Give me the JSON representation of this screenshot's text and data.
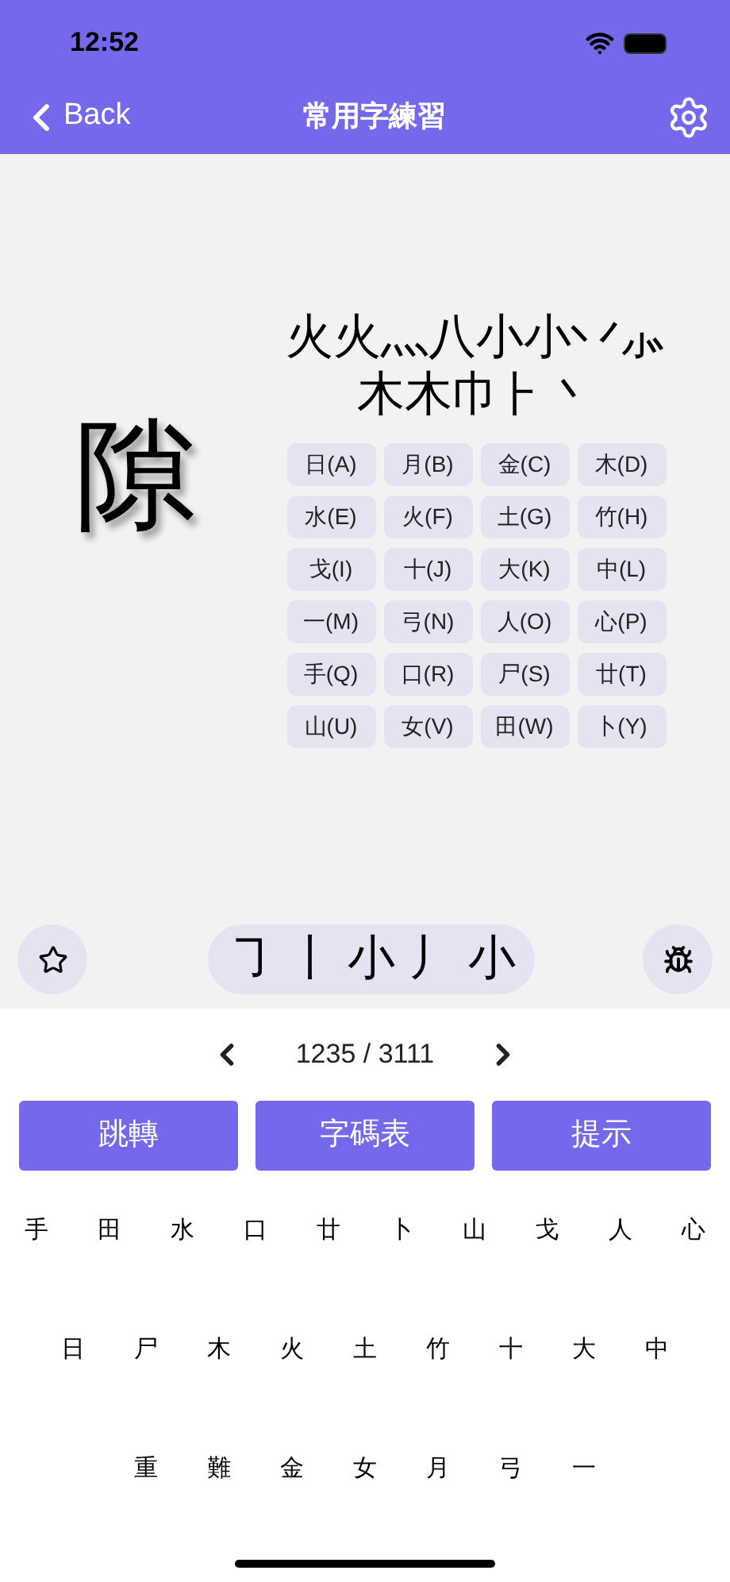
{
  "status_bar": {
    "time": "12:52"
  },
  "nav": {
    "back": "Back",
    "title": "常用字練習"
  },
  "question": {
    "character": "隙",
    "components": [
      [
        "火",
        "火",
        "灬",
        "八",
        "小",
        "小",
        "丷",
        "⺗"
      ],
      [
        "木",
        "木",
        "巾",
        "⺊",
        "丶"
      ]
    ],
    "keys": [
      "日(A)",
      "月(B)",
      "金(C)",
      "木(D)",
      "水(E)",
      "火(F)",
      "土(G)",
      "竹(H)",
      "戈(I)",
      "十(J)",
      "大(K)",
      "中(L)",
      "一(M)",
      "弓(N)",
      "人(O)",
      "心(P)",
      "手(Q)",
      "口(R)",
      "尸(S)",
      "廿(T)",
      "山(U)",
      "女(V)",
      "田(W)",
      "卜(Y)"
    ],
    "input": [
      "㇆",
      "丨",
      "小",
      "丿",
      "小"
    ]
  },
  "pager": {
    "text": "1235 / 3111"
  },
  "buttons": [
    "跳轉",
    "字碼表",
    "提示"
  ],
  "keyboard": [
    [
      "手",
      "田",
      "水",
      "口",
      "廿",
      "卜",
      "山",
      "戈",
      "人",
      "心"
    ],
    [
      "日",
      "尸",
      "木",
      "火",
      "土",
      "竹",
      "十",
      "大",
      "中"
    ],
    [
      "重",
      "難",
      "金",
      "女",
      "月",
      "弓",
      "一"
    ]
  ]
}
